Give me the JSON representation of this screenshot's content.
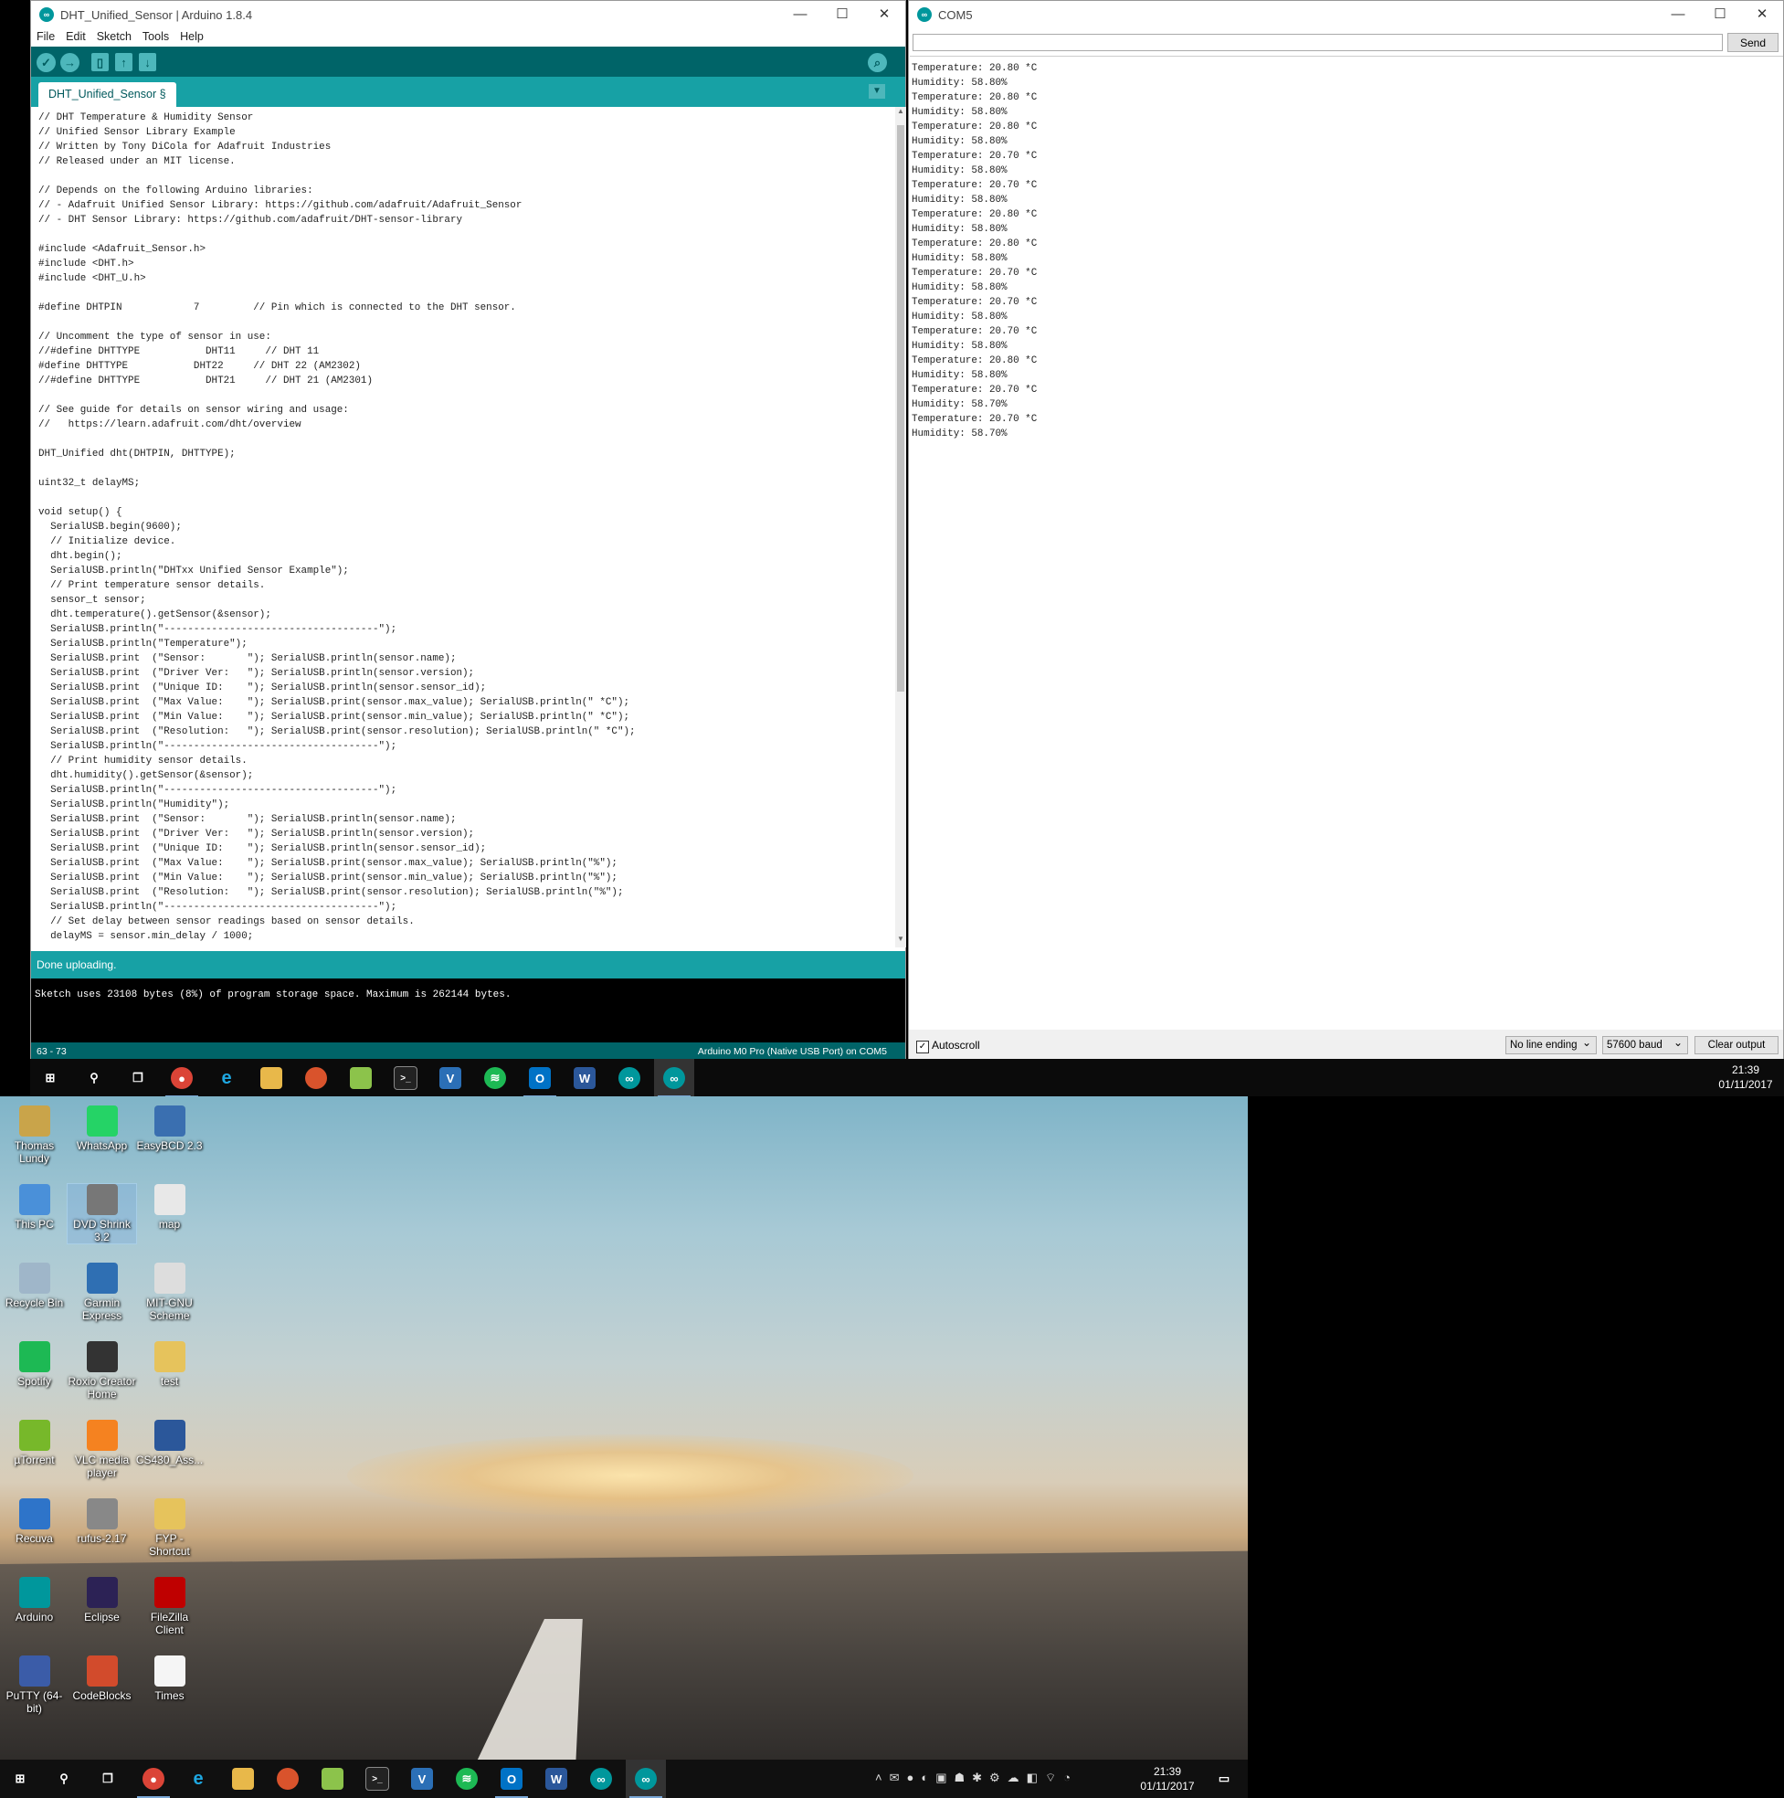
{
  "arduino": {
    "title": "DHT_Unified_Sensor | Arduino 1.8.4",
    "menu": [
      "File",
      "Edit",
      "Sketch",
      "Tools",
      "Help"
    ],
    "tab": "DHT_Unified_Sensor §",
    "code": "// DHT Temperature & Humidity Sensor\n// Unified Sensor Library Example\n// Written by Tony DiCola for Adafruit Industries\n// Released under an MIT license.\n\n// Depends on the following Arduino libraries:\n// - Adafruit Unified Sensor Library: https://github.com/adafruit/Adafruit_Sensor\n// - DHT Sensor Library: https://github.com/adafruit/DHT-sensor-library\n\n#include <Adafruit_Sensor.h>\n#include <DHT.h>\n#include <DHT_U.h>\n\n#define DHTPIN            7         // Pin which is connected to the DHT sensor.\n\n// Uncomment the type of sensor in use:\n//#define DHTTYPE           DHT11     // DHT 11\n#define DHTTYPE           DHT22     // DHT 22 (AM2302)\n//#define DHTTYPE           DHT21     // DHT 21 (AM2301)\n\n// See guide for details on sensor wiring and usage:\n//   https://learn.adafruit.com/dht/overview\n\nDHT_Unified dht(DHTPIN, DHTTYPE);\n\nuint32_t delayMS;\n\nvoid setup() {\n  SerialUSB.begin(9600);\n  // Initialize device.\n  dht.begin();\n  SerialUSB.println(\"DHTxx Unified Sensor Example\");\n  // Print temperature sensor details.\n  sensor_t sensor;\n  dht.temperature().getSensor(&sensor);\n  SerialUSB.println(\"------------------------------------\");\n  SerialUSB.println(\"Temperature\");\n  SerialUSB.print  (\"Sensor:       \"); SerialUSB.println(sensor.name);\n  SerialUSB.print  (\"Driver Ver:   \"); SerialUSB.println(sensor.version);\n  SerialUSB.print  (\"Unique ID:    \"); SerialUSB.println(sensor.sensor_id);\n  SerialUSB.print  (\"Max Value:    \"); SerialUSB.print(sensor.max_value); SerialUSB.println(\" *C\");\n  SerialUSB.print  (\"Min Value:    \"); SerialUSB.print(sensor.min_value); SerialUSB.println(\" *C\");\n  SerialUSB.print  (\"Resolution:   \"); SerialUSB.print(sensor.resolution); SerialUSB.println(\" *C\");\n  SerialUSB.println(\"------------------------------------\");\n  // Print humidity sensor details.\n  dht.humidity().getSensor(&sensor);\n  SerialUSB.println(\"------------------------------------\");\n  SerialUSB.println(\"Humidity\");\n  SerialUSB.print  (\"Sensor:       \"); SerialUSB.println(sensor.name);\n  SerialUSB.print  (\"Driver Ver:   \"); SerialUSB.println(sensor.version);\n  SerialUSB.print  (\"Unique ID:    \"); SerialUSB.println(sensor.sensor_id);\n  SerialUSB.print  (\"Max Value:    \"); SerialUSB.print(sensor.max_value); SerialUSB.println(\"%\");\n  SerialUSB.print  (\"Min Value:    \"); SerialUSB.print(sensor.min_value); SerialUSB.println(\"%\");\n  SerialUSB.print  (\"Resolution:   \"); SerialUSB.print(sensor.resolution); SerialUSB.println(\"%\");\n  SerialUSB.println(\"------------------------------------\");\n  // Set delay between sensor readings based on sensor details.\n  delayMS = sensor.min_delay / 1000;",
    "status": "Done uploading.",
    "console": "Sketch uses 23108 bytes (8%) of program storage space. Maximum is 262144 bytes.",
    "line_indicator": "63 - 73",
    "board": "Arduino M0 Pro (Native USB Port) on COM5"
  },
  "serial": {
    "title": "COM5",
    "input_value": "",
    "send_label": "Send",
    "output": "Temperature: 20.80 *C\nHumidity: 58.80%\nTemperature: 20.80 *C\nHumidity: 58.80%\nTemperature: 20.80 *C\nHumidity: 58.80%\nTemperature: 20.70 *C\nHumidity: 58.80%\nTemperature: 20.70 *C\nHumidity: 58.80%\nTemperature: 20.80 *C\nHumidity: 58.80%\nTemperature: 20.80 *C\nHumidity: 58.80%\nTemperature: 20.70 *C\nHumidity: 58.80%\nTemperature: 20.70 *C\nHumidity: 58.80%\nTemperature: 20.70 *C\nHumidity: 58.80%\nTemperature: 20.80 *C\nHumidity: 58.80%\nTemperature: 20.70 *C\nHumidity: 58.70%\nTemperature: 20.70 *C\nHumidity: 58.70%",
    "autoscroll_label": "Autoscroll",
    "autoscroll_checked": true,
    "line_ending": "No line ending",
    "baud": "57600 baud",
    "clear_label": "Clear output"
  },
  "taskbar_top": {
    "time": "21:39",
    "date": "01/11/2017"
  },
  "taskbar_bottom": {
    "time": "21:39",
    "date": "01/11/2017"
  },
  "desktop_icons": [
    {
      "label": "Thomas Lundy",
      "icon": "user-folder-icon",
      "color": "#c9a44a"
    },
    {
      "label": "WhatsApp",
      "icon": "whatsapp-icon",
      "color": "#25d366"
    },
    {
      "label": "EasyBCD 2.3",
      "icon": "easybcd-icon",
      "color": "#3a6fb0"
    },
    {
      "label": "This PC",
      "icon": "computer-icon",
      "color": "#4a90d9"
    },
    {
      "label": "DVD Shrink 3.2",
      "icon": "dvd-shrink-icon",
      "color": "#777777"
    },
    {
      "label": "map",
      "icon": "image-file-icon",
      "color": "#e8e8e8"
    },
    {
      "label": "Recycle Bin",
      "icon": "recycle-bin-icon",
      "color": "#9fb6c9"
    },
    {
      "label": "Garmin Express",
      "icon": "garmin-icon",
      "color": "#2f6fb3"
    },
    {
      "label": "MIT-GNU Scheme",
      "icon": "scheme-icon",
      "color": "#dddddd"
    },
    {
      "label": "Spotify",
      "icon": "spotify-icon",
      "color": "#1db954"
    },
    {
      "label": "Roxio Creator Home",
      "icon": "roxio-icon",
      "color": "#333333"
    },
    {
      "label": "test",
      "icon": "folder-icon",
      "color": "#e6c35c"
    },
    {
      "label": "µTorrent",
      "icon": "utorrent-icon",
      "color": "#77b82a"
    },
    {
      "label": "VLC media player",
      "icon": "vlc-icon",
      "color": "#f58220"
    },
    {
      "label": "CS430_Ass...",
      "icon": "word-doc-icon",
      "color": "#2b579a"
    },
    {
      "label": "Recuva",
      "icon": "recuva-icon",
      "color": "#2e74c9"
    },
    {
      "label": "rufus-2.17",
      "icon": "rufus-icon",
      "color": "#888888"
    },
    {
      "label": "FYP - Shortcut",
      "icon": "folder-shortcut-icon",
      "color": "#e6c35c"
    },
    {
      "label": "Arduino",
      "icon": "arduino-icon",
      "color": "#00979c"
    },
    {
      "label": "Eclipse",
      "icon": "eclipse-icon",
      "color": "#2c2255"
    },
    {
      "label": "FileZilla Client",
      "icon": "filezilla-icon",
      "color": "#bf0000"
    },
    {
      "label": "PuTTY (64-bit)",
      "icon": "putty-icon",
      "color": "#3b5ca8"
    },
    {
      "label": "CodeBlocks",
      "icon": "codeblocks-icon",
      "color": "#d24b2c"
    },
    {
      "label": "Times",
      "icon": "text-file-icon",
      "color": "#f5f5f5"
    }
  ]
}
